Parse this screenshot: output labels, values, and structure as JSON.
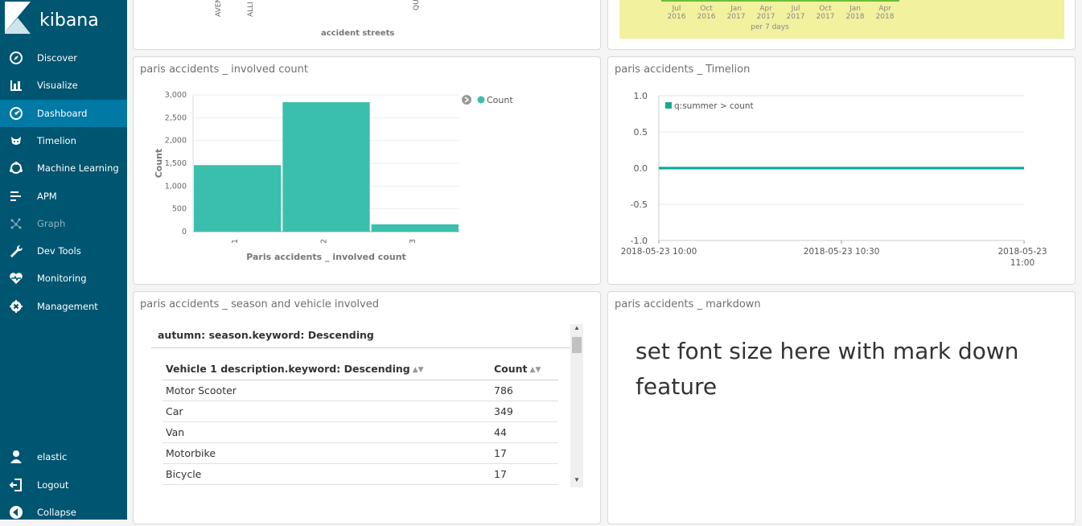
{
  "app": {
    "name": "kibana"
  },
  "sidebar": {
    "items": [
      {
        "label": "Discover",
        "icon": "compass-icon"
      },
      {
        "label": "Visualize",
        "icon": "bar-chart-icon"
      },
      {
        "label": "Dashboard",
        "icon": "dashboard-icon",
        "active": true
      },
      {
        "label": "Timelion",
        "icon": "timelion-icon"
      },
      {
        "label": "Machine Learning",
        "icon": "machine-learning-icon"
      },
      {
        "label": "APM",
        "icon": "apm-icon"
      },
      {
        "label": "Graph",
        "icon": "graph-icon",
        "disabled": true
      },
      {
        "label": "Dev Tools",
        "icon": "wrench-icon"
      },
      {
        "label": "Monitoring",
        "icon": "heartbeat-icon"
      },
      {
        "label": "Management",
        "icon": "gear-icon"
      }
    ],
    "bottom": [
      {
        "label": "elastic",
        "icon": "user-icon"
      },
      {
        "label": "Logout",
        "icon": "logout-icon"
      },
      {
        "label": "Collapse",
        "icon": "collapse-icon"
      }
    ]
  },
  "top_panels": {
    "left": {
      "axis_title": "accident streets",
      "tick_labels": [
        "AVEN",
        "ALLI",
        "QU"
      ]
    },
    "right": {
      "months": [
        "Jul",
        "Oct",
        "Jan",
        "Apr",
        "Jul",
        "Oct",
        "Jan",
        "Apr"
      ],
      "years": [
        "2016",
        "2016",
        "2017",
        "2017",
        "2017",
        "2017",
        "2018",
        "2018"
      ],
      "interval_label": "per 7 days",
      "background": "#f2f19e"
    }
  },
  "panels": {
    "involved": {
      "title": "paris accidents _ involved count"
    },
    "timelion": {
      "title": "paris accidents _ Timelion"
    },
    "season": {
      "title": "paris accidents _ season and vehicle involved"
    },
    "markdown": {
      "title": "paris accidents _ markdown",
      "body": "set font size here with mark down feature"
    }
  },
  "chart_data": [
    {
      "type": "bar",
      "categories": [
        "1",
        "2",
        "3"
      ],
      "series": [
        {
          "name": "Count",
          "values": [
            1460,
            2840,
            160
          ]
        }
      ],
      "xlabel": "Paris accidents _ involved count",
      "ylabel": "Count",
      "ylim": [
        0,
        3000
      ],
      "yticks": [
        "0",
        "500",
        "1,000",
        "1,500",
        "2,000",
        "2,500",
        "3,000"
      ],
      "color": "#3bbfad",
      "legend": "top-right"
    },
    {
      "type": "line",
      "series": [
        {
          "name": "q:summer > count",
          "values": [
            0,
            0
          ]
        }
      ],
      "x": [
        "2018-05-23 10:00",
        "2018-05-23 11:00"
      ],
      "xticks": [
        "2018-05-23 10:00",
        "2018-05-23 10:30",
        "2018-05-23 11:00"
      ],
      "yticks": [
        "1.0",
        "0.5",
        "0.0",
        "-0.5",
        "-1.0"
      ],
      "ylim": [
        -1.0,
        1.0
      ],
      "color": "#00a69b",
      "legend": "top-left"
    }
  ],
  "table": {
    "group_title": "autumn: season.keyword: Descending",
    "columns": [
      "Vehicle 1 description.keyword: Descending",
      "Count"
    ],
    "rows": [
      [
        "Motor Scooter",
        "786"
      ],
      [
        "Car",
        "349"
      ],
      [
        "Van",
        "44"
      ],
      [
        "Motorbike",
        "17"
      ],
      [
        "Bicycle",
        "17"
      ]
    ]
  }
}
